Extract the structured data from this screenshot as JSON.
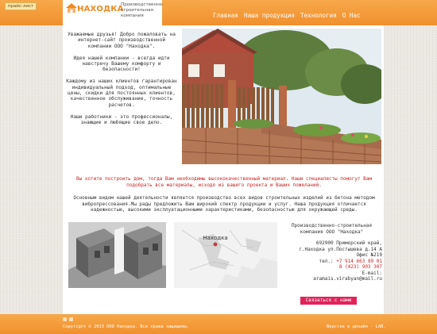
{
  "header": {
    "price_button": "прайс-лист",
    "logo_name": "НАХОДКА",
    "logo_sub": "Производственно-строительная компания",
    "nav": [
      "Главная",
      "Наша продукция",
      "Технология",
      "О Нас"
    ]
  },
  "intro": [
    "Уважаемые друзья! Добро пожаловать на интернет-сайт производственной компании ООО \"Находка\".",
    "Идея нашей компании - всегда идти навстречу Вашему комфорту и безопасности!",
    "Каждому из наших клиентов гарантирован индивидуальный подход, оптимальные цены, скидки для постоянных клиентов, качественное обслуживание, точность расчетов.",
    "Наши работники - это профессионалы, знающие и любящие свое дело."
  ],
  "red_text": "Вы хотите построить дом, тогда Вам необходимы высококачественный материал. Наши специалисты помогут Вам подобрать все материалы, исходя из вашего проекта и Ваших пожеланий.",
  "main_text": "Основным видом нашей деятельности является производство всех видов строительных изделий из бетона методом вибропрессования.Мы рады предложить Вам широкий спектр продукции и услуг. Наша продукция отличается надежностью, высокими эксплуатационными характеристиками, безопасностью для окружающей среды.",
  "map": {
    "label": "Находка"
  },
  "company": {
    "name": "Производственно-строительная компания ООО \"Находка\"",
    "addr1": "692900 Приморский край,",
    "addr2": "г.Находка ул.Постышева д.14 А",
    "office": "Офис №219",
    "tel_label": "тел.:",
    "tel1": "+7 914 663 89 01",
    "tel2": "8 (423) 903 307",
    "email_label": "E-mail:",
    "email": "aramais.virabyan@mail.ru",
    "contact_button": "Связаться с нами"
  },
  "footer": {
    "copyright": "Copyright © 2013 ООО Находка. Все права защищены.",
    "dev": "Верстка и дизайн - LAB."
  },
  "colors": {
    "orange": "#f0902e",
    "red_text": "#cc1f1f",
    "button": "#e2235a"
  }
}
